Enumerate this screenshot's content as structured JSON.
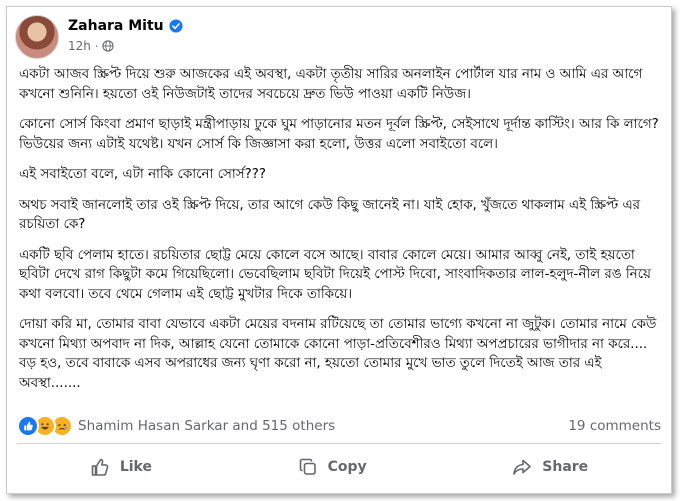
{
  "post": {
    "author": "Zahara Mitu",
    "time": "12h",
    "separator": "·",
    "paragraphs": [
      "একটা আজব স্ক্রিপ্ট দিয়ে শুরু আজকের এই অবস্থা, একটা তৃতীয় সারির অনলাইন পোর্টাল যার নাম ও আমি এর আগে কখনো শুনিনি। হয়তো ওই নিউজটাই তাদের সবচেয়ে দ্রুত ভিউ পাওয়া একটি নিউজ।",
      "কোনো সোর্স কিংবা প্রমাণ ছাড়াই মন্ত্রীপাড়ায় ঢুকে ঘুম পাড়ানোর মতন দূর্বল স্ক্রিপ্ট, সেইসাথে দূর্দান্ত কাস্টিং। আর কি লাগে? ভিউয়ের জন্য এটাই যথেষ্ট। যখন সোর্স কি জিজ্ঞাসা করা হলো, উত্তর এলো সবাইতো বলে।",
      "এই সবাইতো বলে, এটা নাকি কোনো সোর্স???",
      "অথচ সবাই জানলোই তার ওই স্ক্রিপ্ট দিয়ে, তার আগে কেউ কিছু জানেই না। যাই হোক, খুঁজতে থাকলাম এই স্ক্রিপ্ট এর রচয়িতা কে?",
      "একটি ছবি পেলাম হাতে। রচয়িতার ছোট্ট মেয়ে কোলে বসে আছে। বাবার কোলে মেয়ে। আমার আব্বু নেই, তাই হয়তো ছবিটা দেখে রাগ কিছুটা কমে গিয়েছিলো। ভেবেছিলাম ছবিটা দিয়েই পোস্ট দিবো, সাংবাদিকতার লাল-হলুদ-নীল রঙ নিয়ে কথা বলবো। তবে থেমে গেলাম এই ছোট্ট মুখটার দিকে তাকিয়ে।",
      "দোয়া করি মা, তোমার বাবা যেভাবে একটা মেয়ের বদনাম রটিয়েছে তা তোমার ভাগ্যে কখনো না জুটুক। তোমার নামে কেউ কখনো মিথ্যা অপবাদ না দিক, আল্লাহ যেনো তোমাকে কোনো পাড়া-প্রতিবেশীরও মিথ্যা অপপ্রচারের ভাগীদার না করে.... বড় হও, তবে বাবাকে এসব অপরাধের জন্য ঘৃণা করো না, হয়তো তোমার মুখে ভাত তুলে দিতেই আজ তার এই অবস্থা......."
    ]
  },
  "stats": {
    "reactions_text": "Shamim Hasan Sarkar and 515 others",
    "comments_text": "19 comments",
    "reaction_icons": [
      "like-icon",
      "haha-icon",
      "sad-icon"
    ]
  },
  "actions": {
    "like": "Like",
    "copy": "Copy",
    "share": "Share"
  },
  "colors": {
    "verified": "#1877f2",
    "like_reaction": "#1877f2",
    "emoji_reaction": "#f7b125",
    "secondary_text": "#65676b"
  }
}
